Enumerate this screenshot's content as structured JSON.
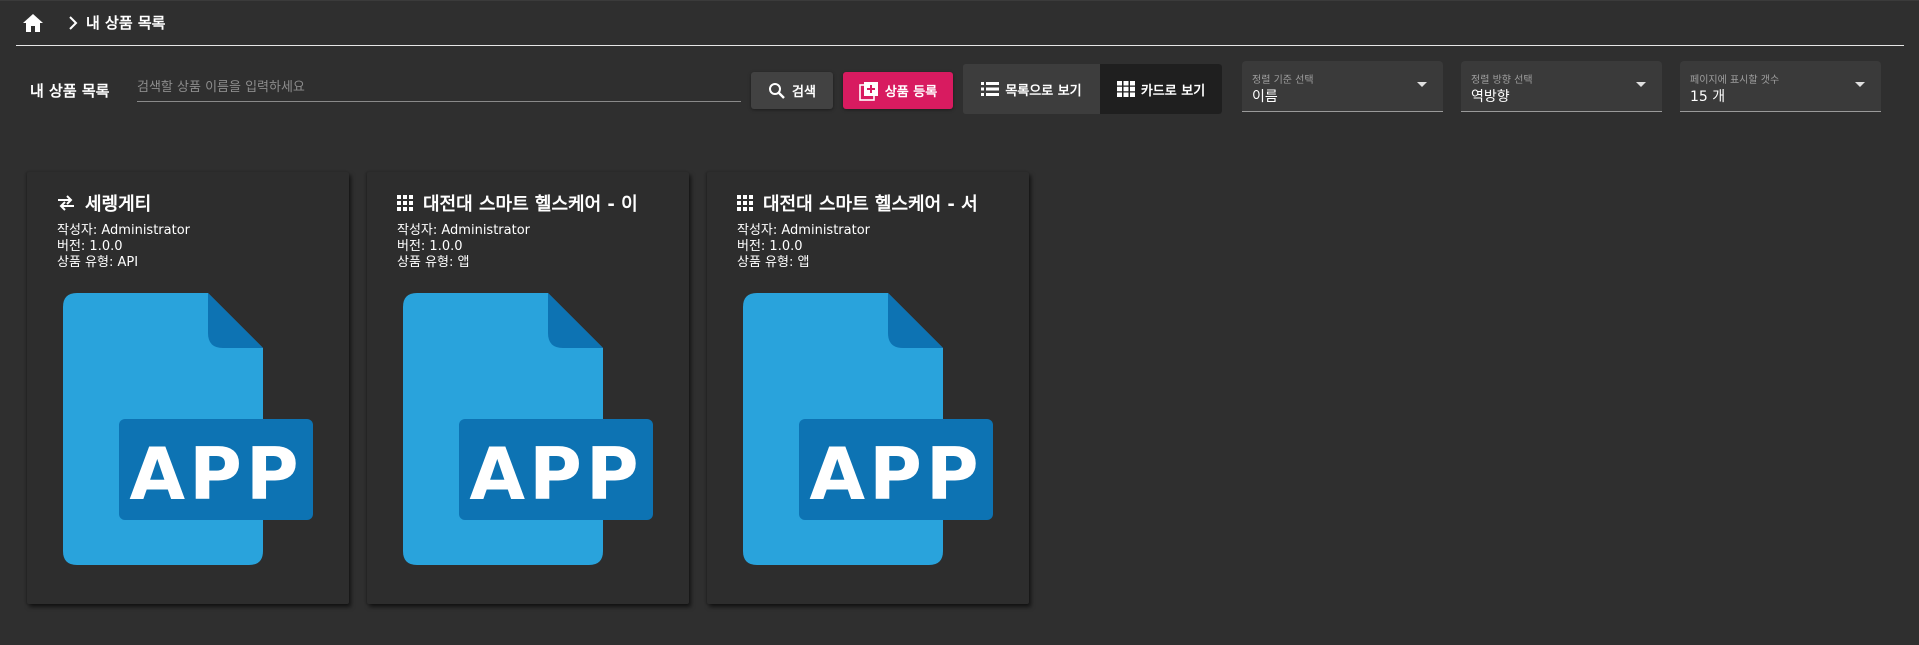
{
  "breadcrumb": {
    "home_icon": "home-icon",
    "separator_icon": "chevron-right-icon",
    "current": "내 상품 목록"
  },
  "toolbar": {
    "title": "내 상품 목록",
    "search_placeholder": "검색할 상품 이름을 입력하세요",
    "search_value": "",
    "search_button": "검색",
    "register_button": "상품 등록",
    "view_list_label": "목록으로 보기",
    "view_card_label": "카드로 보기",
    "active_view": "card"
  },
  "filters": {
    "sort_by": {
      "caption": "정렬 기준 선택",
      "value": "이름"
    },
    "sort_dir": {
      "caption": "정렬 방향 선택",
      "value": "역방향"
    },
    "per_page": {
      "caption": "페이지에 표시할 갯수",
      "value": "15 개"
    }
  },
  "cards": [
    {
      "icon": "swap-horizontal-icon",
      "title": "세렝게티",
      "author": "작성자: Administrator",
      "version": "버전: 1.0.0",
      "type": "상품 유형: API",
      "image_label": "APP"
    },
    {
      "icon": "apps-grid-icon",
      "title": "대전대 스마트 헬스케어 - 이",
      "author": "작성자: Administrator",
      "version": "버전: 1.0.0",
      "type": "상품 유형: 앱",
      "image_label": "APP"
    },
    {
      "icon": "apps-grid-icon",
      "title": "대전대 스마트 헬스케어 - 서",
      "author": "작성자: Administrator",
      "version": "버전: 1.0.0",
      "type": "상품 유형: 앱",
      "image_label": "APP"
    }
  ],
  "colors": {
    "background": "#2f2f2f",
    "accent": "#d81b60",
    "app_icon_light": "#29a3dc",
    "app_icon_dark": "#0d73b3"
  }
}
